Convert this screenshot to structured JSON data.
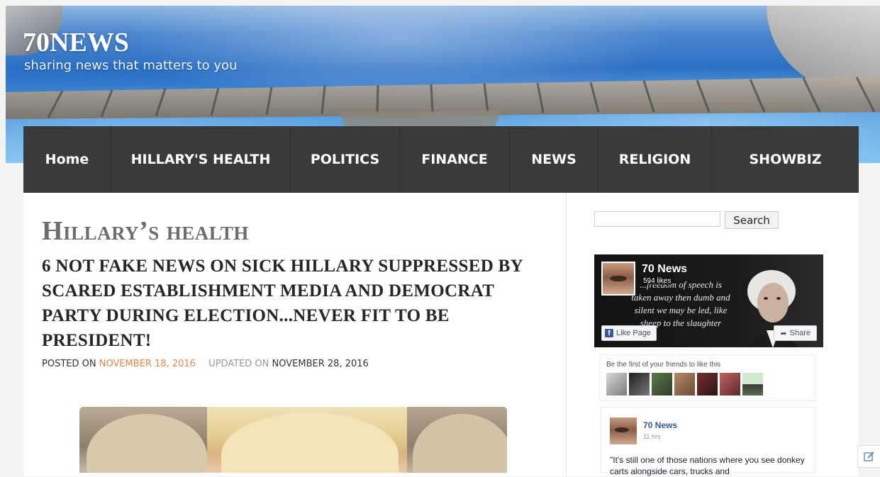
{
  "site": {
    "title": "70NEWS",
    "tagline": "sharing news that matters to you"
  },
  "nav": {
    "items": [
      {
        "label": "Home"
      },
      {
        "label": "HILLARY'S HEALTH"
      },
      {
        "label": "POLITICS"
      },
      {
        "label": "FINANCE"
      },
      {
        "label": "NEWS"
      },
      {
        "label": "RELIGION"
      },
      {
        "label": "SHOWBIZ"
      }
    ]
  },
  "article": {
    "category": "Hillary’s health",
    "title": "6 NOT FAKE NEWS ON SICK HILLARY SUPPRESSED BY SCARED ESTABLISHMENT MEDIA AND DEMOCRAT PARTY DURING ELECTION...NEVER FIT TO BE PRESIDENT!",
    "meta": {
      "posted_prefix": "POSTED ON",
      "posted_date": "NOVEMBER 18, 2016",
      "updated_prefix": "UPDATED ON",
      "updated_date": "NOVEMBER 28, 2016"
    }
  },
  "sidebar": {
    "search": {
      "value": "",
      "button_label": "Search"
    },
    "facebook": {
      "page_name": "70 News",
      "likes": "594 likes",
      "cover_quote": "...freedom of speech is taken away then dumb and silent we may be led, like sheep to the slaughter",
      "like_button": "Like Page",
      "share_button": "Share",
      "friends_text": "Be the first of your friends to like this",
      "post": {
        "author": "70 News",
        "time": "11 hrs",
        "text": "\"It's still one of those nations where you see donkey carts alongside cars, trucks and"
      }
    }
  },
  "colors": {
    "nav_bg": "#3a3a3a",
    "date_link": "#e0884a",
    "fb_blue": "#3b5998"
  }
}
